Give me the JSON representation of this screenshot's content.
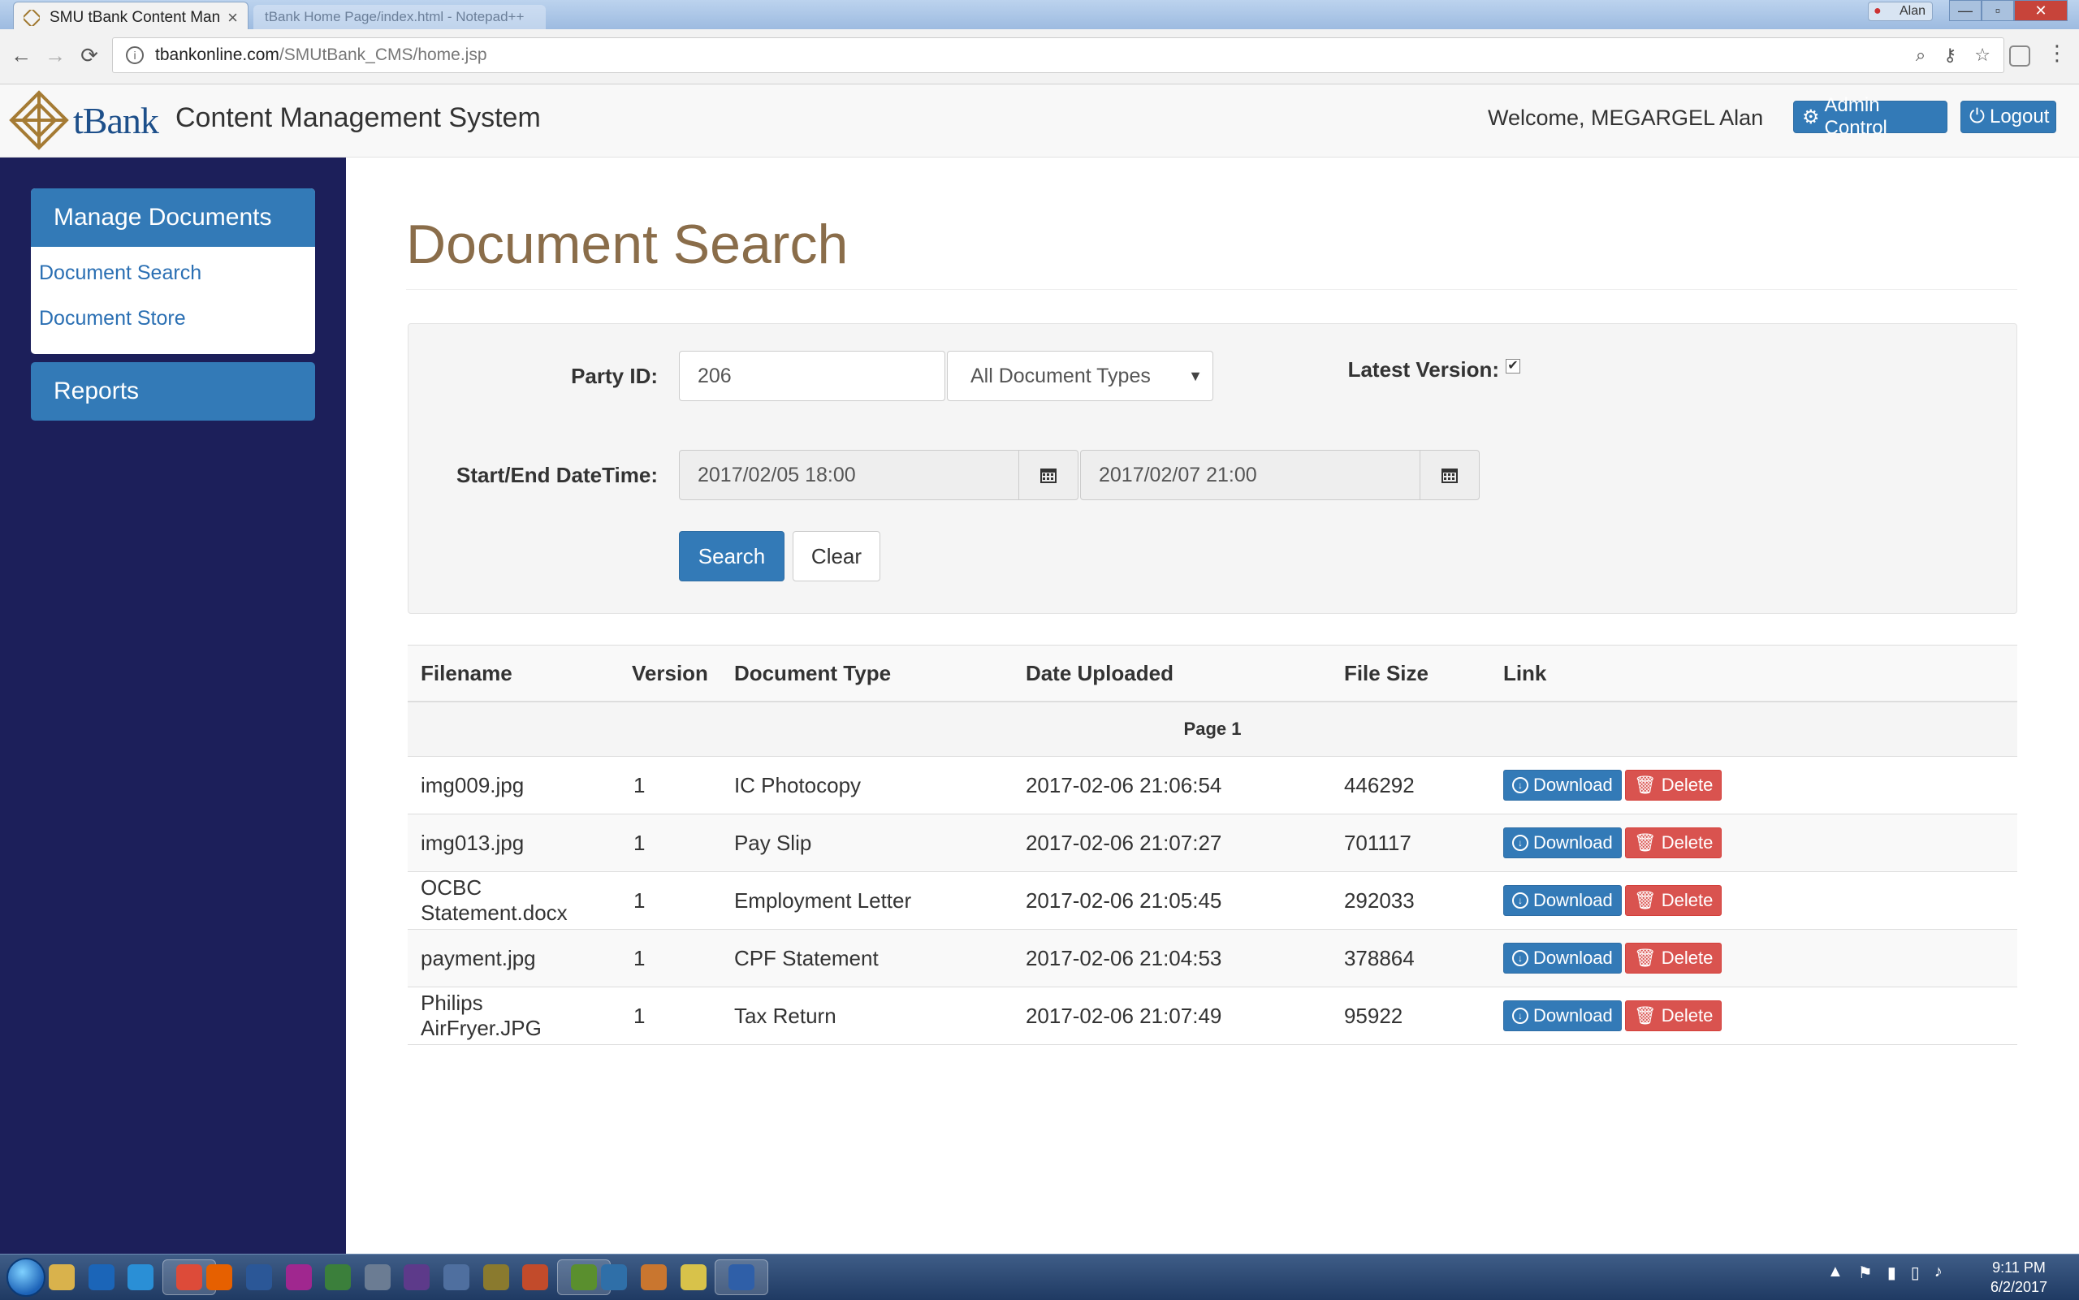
{
  "browser": {
    "tab_title": "SMU tBank Content Man",
    "tab_close": "×",
    "inactive_tab_title": "tBank Home Page/index.html - Notepad++",
    "user_chip": "Alan",
    "url_host": "tbankonline.com",
    "url_path": "/SMUtBank_CMS/home.jsp",
    "window_controls": {
      "minimize": "—",
      "maximize": "▫",
      "close": "✕"
    },
    "nav": {
      "back": "←",
      "forward": "→",
      "reload": "⟳"
    },
    "omnibox_icons": {
      "zoom": "⌕",
      "key": "⚷",
      "bookmark": "☆"
    },
    "menu_glyph": "⋮"
  },
  "header": {
    "brand": "tBank",
    "app_title": "Content Management System",
    "welcome": "Welcome, MEGARGEL Alan",
    "admin_label": "Admin Control",
    "admin_icon": "⚙",
    "logout_label": "Logout",
    "logout_icon": "⏻"
  },
  "sidebar": {
    "manage_heading": "Manage Documents",
    "links": [
      "Document Search",
      "Document Store"
    ],
    "reports_heading": "Reports"
  },
  "search": {
    "title": "Document Search",
    "party_id_label": "Party ID:",
    "party_id_value": "206",
    "doc_type_selected": "All Document Types",
    "latest_version_label": "Latest Version:",
    "latest_version_checked": "✔",
    "datetime_label": "Start/End DateTime:",
    "start_datetime": "2017/02/05 18:00",
    "end_datetime": "2017/02/07 21:00",
    "search_button": "Search",
    "clear_button": "Clear"
  },
  "results": {
    "columns": [
      "Filename",
      "Version",
      "Document Type",
      "Date Uploaded",
      "File Size",
      "Link"
    ],
    "page_label": "Page 1",
    "download_label": "Download",
    "delete_label": "Delete",
    "rows": [
      [
        "img009.jpg",
        "1",
        "IC Photocopy",
        "2017-02-06 21:06:54",
        "446292"
      ],
      [
        "img013.jpg",
        "1",
        "Pay Slip",
        "2017-02-06 21:07:27",
        "701117"
      ],
      [
        "OCBC Statement.docx",
        "1",
        "Employment Letter",
        "2017-02-06 21:05:45",
        "292033"
      ],
      [
        "payment.jpg",
        "1",
        "CPF Statement",
        "2017-02-06 21:04:53",
        "378864"
      ],
      [
        "Philips AirFryer.JPG",
        "1",
        "Tax Return",
        "2017-02-06 21:07:49",
        "95922"
      ]
    ]
  },
  "taskbar": {
    "apps": [
      "explorer-icon",
      "outlook-icon",
      "ie-icon",
      "chrome-icon",
      "firefox-icon",
      "powershell-icon",
      "app-icon",
      "sublime-icon",
      "settings-icon",
      "eclipse-icon",
      "box-icon",
      "security-icon",
      "apps-grid-icon",
      "image-editor-icon",
      "sas-icon",
      "compass-icon",
      "sticky-notes-icon",
      "remote-desktop-icon"
    ],
    "time": "9:11 PM",
    "date": "6/2/2017"
  },
  "colors": {
    "primary": "#337ab7",
    "danger": "#d9534f",
    "sidebar_bg": "#1c1f5a",
    "title_brown": "#8a6d4a"
  }
}
